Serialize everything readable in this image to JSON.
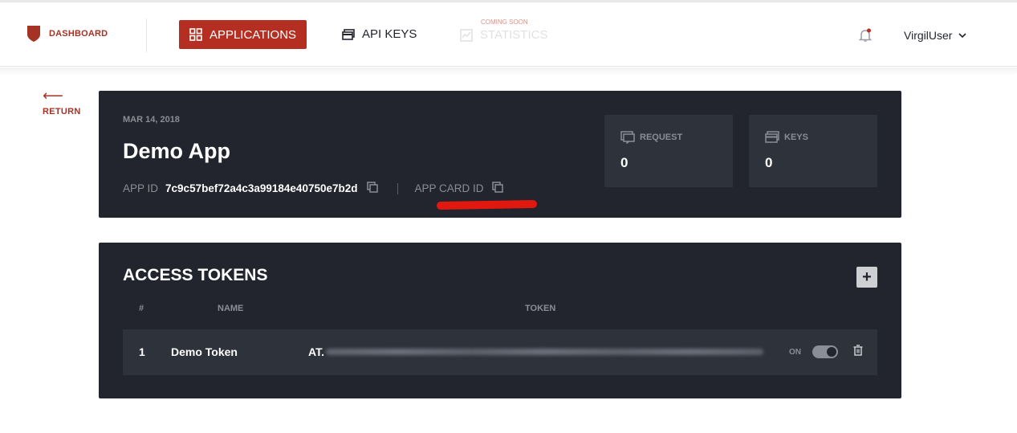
{
  "nav": {
    "logo_label": "DASHBOARD",
    "applications_label": "APPLICATIONS",
    "api_keys_label": "API KEYS",
    "statistics_badge": "COMING SOON",
    "statistics_label": "STATISTICS",
    "user_name": "VirgilUser",
    "icons": [
      "shield-icon",
      "grid-icon",
      "key-card-icon",
      "chart-icon",
      "bell-icon",
      "chevron-down-icon"
    ]
  },
  "return": {
    "arrow": "⟵",
    "label": "RETURN"
  },
  "app": {
    "date": "MAR 14, 2018",
    "name": "Demo App",
    "app_id_label": "APP ID",
    "app_id_value": "7c9c57bef72a4c3a99184e40750e7b2d",
    "app_card_id_label": "APP CARD ID",
    "stats": {
      "request_label": "REQUEST",
      "request_value": "0",
      "keys_label": "KEYS",
      "keys_value": "0"
    }
  },
  "tokens": {
    "title": "ACCESS TOKENS",
    "add_label": "+",
    "columns": {
      "num": "#",
      "name": "NAME",
      "token": "TOKEN"
    },
    "rows": [
      {
        "num": "1",
        "name": "Demo Token",
        "token_prefix": "AT.",
        "status_label": "ON",
        "enabled": true
      }
    ]
  },
  "colors": {
    "brand": "#b42f22",
    "card_bg": "#22252d",
    "panel_bg": "#2e323b",
    "muted_text": "#8a8d95"
  }
}
